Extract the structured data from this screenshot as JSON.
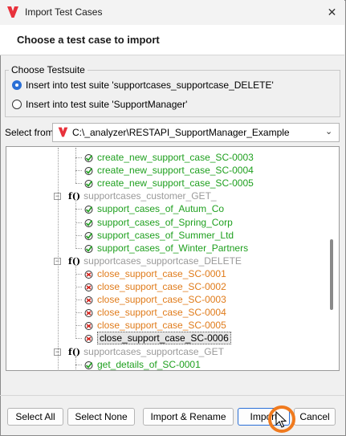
{
  "window": {
    "title": "Import Test Cases",
    "close_glyph": "✕"
  },
  "header": {
    "title": "Choose a test case to import"
  },
  "testsuite_group": {
    "label": "Choose Testsuite",
    "options": [
      {
        "label": "Insert into test suite 'supportcases_supportcase_DELETE'",
        "selected": true
      },
      {
        "label": "Insert into test suite 'SupportManager'",
        "selected": false
      }
    ]
  },
  "select_from": {
    "label": "Select from",
    "value": "C:\\_analyzer\\RESTAPI_SupportManager_Example",
    "arrow": "⌄"
  },
  "tree": {
    "nodes": [
      {
        "kind": "case",
        "color": "green",
        "label": "create_new_support_case_SC-0003"
      },
      {
        "kind": "case",
        "color": "green",
        "label": "create_new_support_case_SC-0004"
      },
      {
        "kind": "case",
        "color": "green",
        "label": "create_new_support_case_SC-0005"
      },
      {
        "kind": "suite",
        "label": "supportcases_customer_GET_",
        "fn": "f()"
      },
      {
        "kind": "case",
        "color": "green",
        "label": "support_cases_of_Autum_Co"
      },
      {
        "kind": "case",
        "color": "green",
        "label": "support_cases_of_Spring_Corp"
      },
      {
        "kind": "case",
        "color": "green",
        "label": "support_cases_of_Summer_Ltd"
      },
      {
        "kind": "case",
        "color": "green",
        "label": "support_cases_of_Winter_Partners"
      },
      {
        "kind": "suite",
        "label": "supportcases_supportcase_DELETE",
        "fn": "f()"
      },
      {
        "kind": "case",
        "color": "orange",
        "label": "close_support_case_SC-0001"
      },
      {
        "kind": "case",
        "color": "orange",
        "label": "close_support_case_SC-0002"
      },
      {
        "kind": "case",
        "color": "orange",
        "label": "close_support_case_SC-0003"
      },
      {
        "kind": "case",
        "color": "orange",
        "label": "close_support_case_SC-0004"
      },
      {
        "kind": "case",
        "color": "orange",
        "label": "close_support_case_SC-0005"
      },
      {
        "kind": "case",
        "color": "selected",
        "label": "close_support_case_SC-0006"
      },
      {
        "kind": "suite",
        "label": "supportcases_supportcase_GET",
        "fn": "f()"
      },
      {
        "kind": "case",
        "color": "green",
        "label": "get_details_of_SC-0001"
      }
    ]
  },
  "buttons": {
    "select_all": "Select All",
    "select_none": "Select None",
    "import_rename": "Import & Rename",
    "import": "Import",
    "cancel": "Cancel"
  },
  "colors": {
    "accent": "#2a6fd6",
    "green": "#1fa01f",
    "orange": "#e07b1a",
    "highlight": "#f07a1e",
    "logo": "#e8323c"
  }
}
